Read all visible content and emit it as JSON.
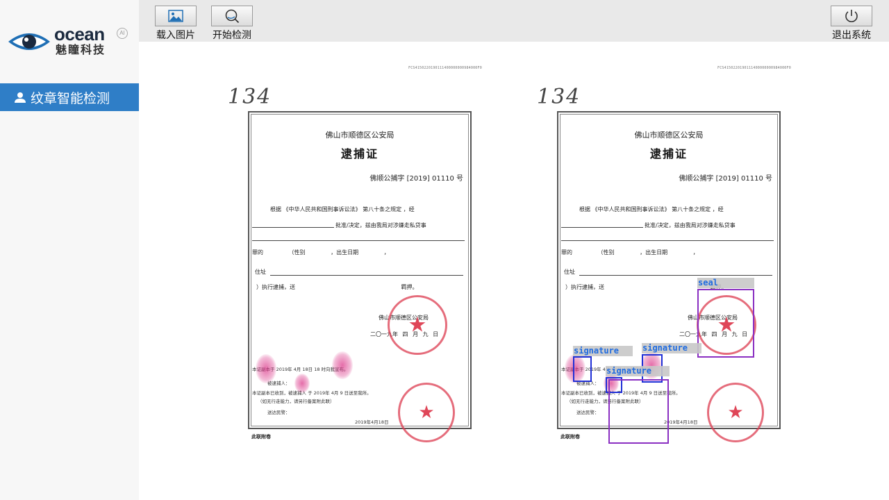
{
  "brand": {
    "name_en": "ocean",
    "name_cn": "魅瞳科技",
    "badge": "AI",
    "accent": "#2f7ec7"
  },
  "sidebar": {
    "items": [
      {
        "label": "纹章智能检测",
        "icon": "user-icon",
        "selected": true
      }
    ]
  },
  "toolbar": {
    "load_image": {
      "label": "载入图片",
      "icon": "image-icon"
    },
    "start_detect": {
      "label": "开始检测",
      "icon": "search-icon"
    },
    "exit": {
      "label": "退出系统",
      "icon": "power-icon"
    }
  },
  "document": {
    "serial": "FCS4150220190111400000000984000F0",
    "handwritten_number": "134",
    "agency": "佛山市顺德区公安局",
    "title": "逮捕证",
    "doc_number": "佛顺公捕字 [2019] 01110 号",
    "line1": "根据 《中华人民共和国刑事诉讼法》 第八十条之规定 ，经",
    "line2": "批准/决定，兹由我局对涉嫌走私贷事",
    "line3": "罪的 （性别 ，出生日期 ，",
    "line4": "住址",
    "line5": "）执行逮捕，送 羁押。",
    "seal_text": "佛山市顺德区公安局",
    "date": "二〇一九年 四 月 九 日",
    "receipt1": "本证副本于 2019年 4月 18日 18 时向我宣布。",
    "receipt2": "被逮捕人：",
    "receipt3": "本证副本已收到，被逮捕人 于 2019年 4月 9 日送至我所。",
    "receipt4": "（如无行走能力，请另行备案附此联）",
    "receipt5": "送达民警：",
    "receipt_date": "2019年4月18日",
    "footer": "此联附卷"
  },
  "detections": [
    {
      "label": "seal",
      "color": "#8a2fc2"
    },
    {
      "label": "signature",
      "color": "#1f2fd6"
    },
    {
      "label": "signature",
      "color": "#1f2fd6"
    },
    {
      "label": "signature",
      "color": "#1f2fd6"
    },
    {
      "label": "",
      "color": "#8a2fc2"
    }
  ]
}
